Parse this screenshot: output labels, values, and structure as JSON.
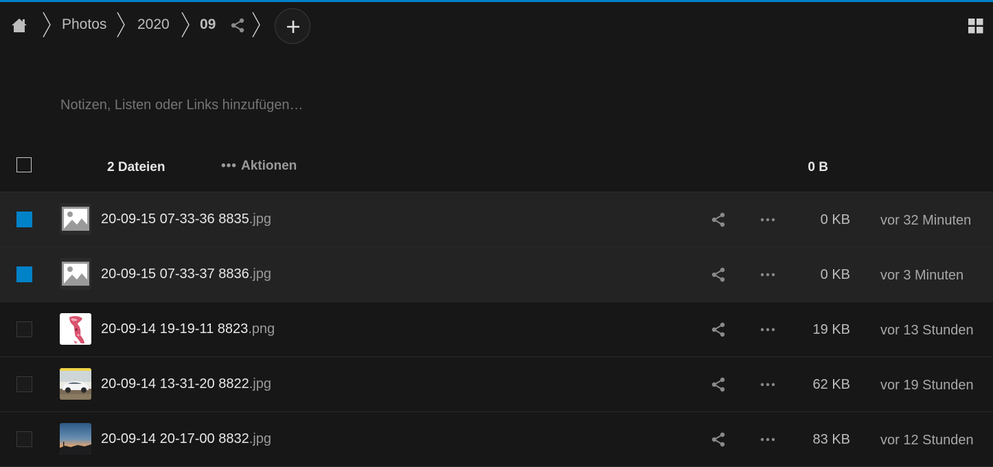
{
  "accent_color": "#0082c9",
  "breadcrumb": {
    "home_icon": "home-icon",
    "items": [
      {
        "label": "Photos"
      },
      {
        "label": "2020"
      },
      {
        "label": "09"
      }
    ],
    "share_icon": "share-icon",
    "add_icon": "plus-icon"
  },
  "view_toggle_icon": "grid-view-icon",
  "notes": {
    "placeholder": "Notizen, Listen oder Links hinzufügen…"
  },
  "header": {
    "count_label": "2 Dateien",
    "actions_dots": "•••",
    "actions_label": "Aktionen",
    "total_size": "0 B"
  },
  "files": [
    {
      "name": "20-09-15 07-33-36 8835",
      "ext": ".jpg",
      "size": "0 KB",
      "modified": "vor 32 Minuten",
      "selected": true,
      "thumb": "placeholder-image-icon"
    },
    {
      "name": "20-09-15 07-33-37 8836",
      "ext": ".jpg",
      "size": "0 KB",
      "modified": "vor 3 Minuten",
      "selected": true,
      "thumb": "placeholder-image-icon"
    },
    {
      "name": "20-09-14 19-19-11 8823",
      "ext": ".png",
      "size": "19 KB",
      "modified": "vor 13 Stunden",
      "selected": false,
      "thumb": "pink-drawing-thumbnail"
    },
    {
      "name": "20-09-14 13-31-20 8822",
      "ext": ".jpg",
      "size": "62 KB",
      "modified": "vor 19 Stunden",
      "selected": false,
      "thumb": "car-photo-thumbnail"
    },
    {
      "name": "20-09-14 20-17-00 8832",
      "ext": ".jpg",
      "size": "83 KB",
      "modified": "vor 12 Stunden",
      "selected": false,
      "thumb": "sunset-photo-thumbnail"
    }
  ]
}
